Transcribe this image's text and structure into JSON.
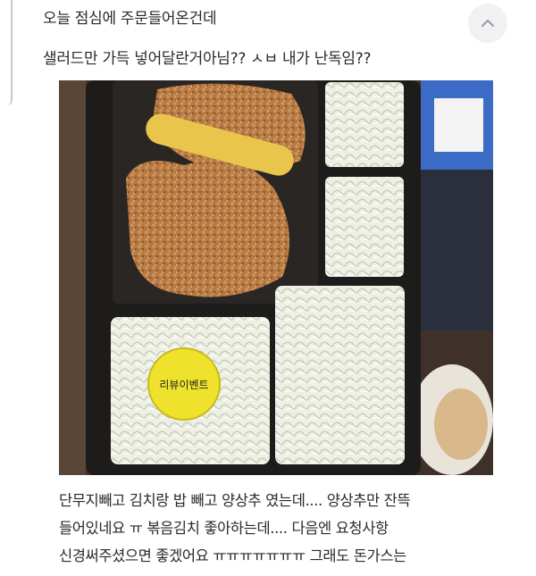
{
  "post": {
    "line1": "오늘 점심에 주문들어온건데",
    "line2": "샐러드만 가득 넣어달란거아님?? ㅅㅂ 내가 난독임??"
  },
  "photo": {
    "sticker_text": "리뷰이벤트"
  },
  "review": {
    "line1": "단무지빼고 김치랑 밥 빼고 양상추 였는데.... 양상추만 잔뜩",
    "line2": "들어있네요 ㅠ 볶음김치 좋아하는데.... 다음엔 요청사항",
    "line3": "신경써주셨으면 좋겠어요 ㅠㅠㅠㅠㅠㅠㅠ 그래도 돈가스는"
  },
  "icons": {
    "scroll_up": "chevron-up-icon"
  },
  "colors": {
    "background": "#ffffff",
    "text": "#2a2a2a",
    "button": "#f1f1f3",
    "chevron": "#9a9aa6"
  }
}
